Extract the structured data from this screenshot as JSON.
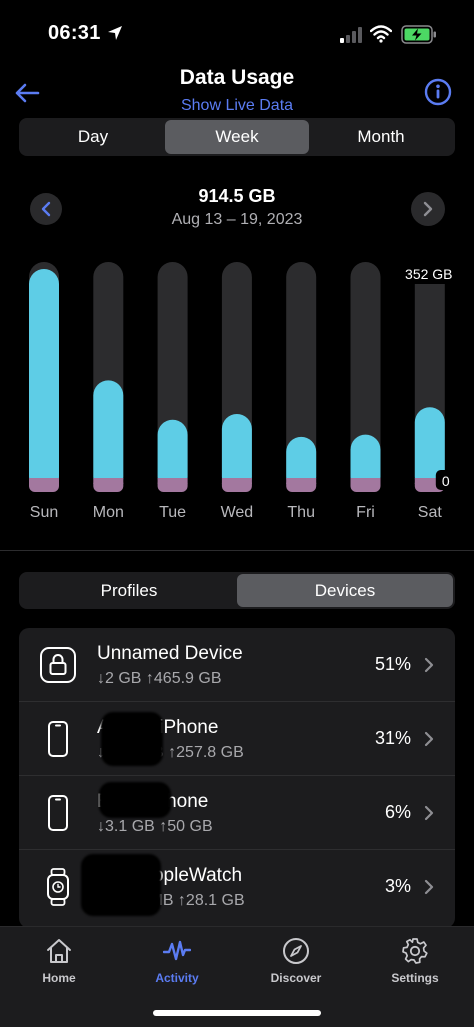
{
  "status_bar": {
    "time": "06:31"
  },
  "header": {
    "title": "Data Usage",
    "live_link": "Show Live Data"
  },
  "range_tabs": [
    {
      "label": "Day",
      "active": false
    },
    {
      "label": "Week",
      "active": true
    },
    {
      "label": "Month",
      "active": false
    }
  ],
  "period": {
    "total": "914.5 GB",
    "dates": "Aug 13 – 19, 2023"
  },
  "chart_data": {
    "type": "bar",
    "categories": [
      "Sun",
      "Mon",
      "Tue",
      "Wed",
      "Thu",
      "Fri",
      "Sat"
    ],
    "values": [
      352,
      157,
      88,
      98,
      58,
      62,
      110
    ],
    "ylim": [
      0,
      352
    ],
    "tick_labels": {
      "max": "352 GB",
      "min": "0"
    },
    "colors": {
      "usage": "#5ecde6",
      "base": "#a3789f",
      "track": "#2c2c2e"
    }
  },
  "view_tabs": [
    {
      "label": "Profiles",
      "active": false
    },
    {
      "label": "Devices",
      "active": true
    }
  ],
  "devices": [
    {
      "icon": "lock-icon",
      "name": "Unnamed Device",
      "usage": "↓2 GB ↑465.9 GB",
      "share": "51%"
    },
    {
      "icon": "phone-icon",
      "name": "AMWs-iPhone",
      "usage": "↓24.9 GB ↑257.8 GB",
      "share": "31%"
    },
    {
      "icon": "phone-icon",
      "name": "Erin's iPhone",
      "usage": "↓3.1 GB ↑50 GB",
      "share": "6%"
    },
    {
      "icon": "watch-icon",
      "name": "ErinsAppleWatch",
      "usage": "↓186.4 MB ↑28.1 GB",
      "share": "3%"
    }
  ],
  "tab_bar": [
    {
      "label": "Home",
      "icon": "home-icon",
      "active": false
    },
    {
      "label": "Activity",
      "icon": "activity-icon",
      "active": true
    },
    {
      "label": "Discover",
      "icon": "compass-icon",
      "active": false
    },
    {
      "label": "Settings",
      "icon": "gear-icon",
      "active": false
    }
  ],
  "accent_color": "#5b7cf2"
}
